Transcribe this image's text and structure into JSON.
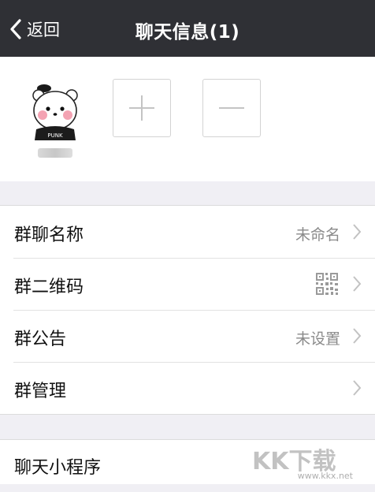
{
  "navbar": {
    "back_label": "返回",
    "title": "聊天信息(1)"
  },
  "members": {
    "avatar_icon": "bear-avatar-icon",
    "avatar_badge": "PUNK"
  },
  "settings": [
    {
      "label": "群聊名称",
      "value": "未命名"
    },
    {
      "label": "群二维码",
      "value": "",
      "icon": "qr-code-icon"
    },
    {
      "label": "群公告",
      "value": "未设置"
    },
    {
      "label": "群管理",
      "value": ""
    }
  ],
  "settings2": [
    {
      "label": "聊天小程序"
    }
  ],
  "watermark": {
    "text": "KK下载",
    "url": "www.kkx.net"
  },
  "colors": {
    "navbar_bg": "#2f3035",
    "page_bg": "#f0eff4",
    "muted_text": "#8a8a8a"
  }
}
